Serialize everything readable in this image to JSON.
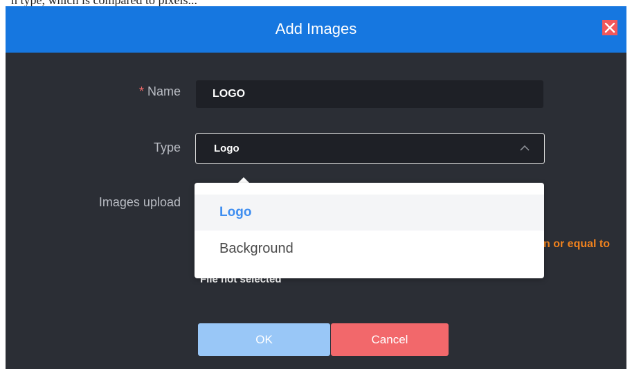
{
  "background_text": "n type, which is compared to pixels...",
  "dialog": {
    "title": "Add Images",
    "close_icon": "close-icon"
  },
  "form": {
    "name_required_mark": "*",
    "name_label": "Name",
    "name_value": "LOGO",
    "type_label": "Type",
    "type_value": "Logo",
    "type_chevron_icon": "chevron-up-icon",
    "upload_label": "Images upload",
    "size_hint_partial": "n or equal to",
    "file_status": "File not selected"
  },
  "type_dropdown": {
    "options": [
      "Logo",
      "Background"
    ],
    "selected": "Logo"
  },
  "buttons": {
    "ok": "OK",
    "cancel": "Cancel"
  },
  "colors": {
    "titlebar": "#1677e0",
    "dialog_bg": "#2b2e35",
    "ok_disabled": "#99c7f7",
    "cancel": "#f2686b",
    "close": "#f2585b",
    "hint": "#f0821e",
    "selected_option": "#3f8ef0"
  }
}
